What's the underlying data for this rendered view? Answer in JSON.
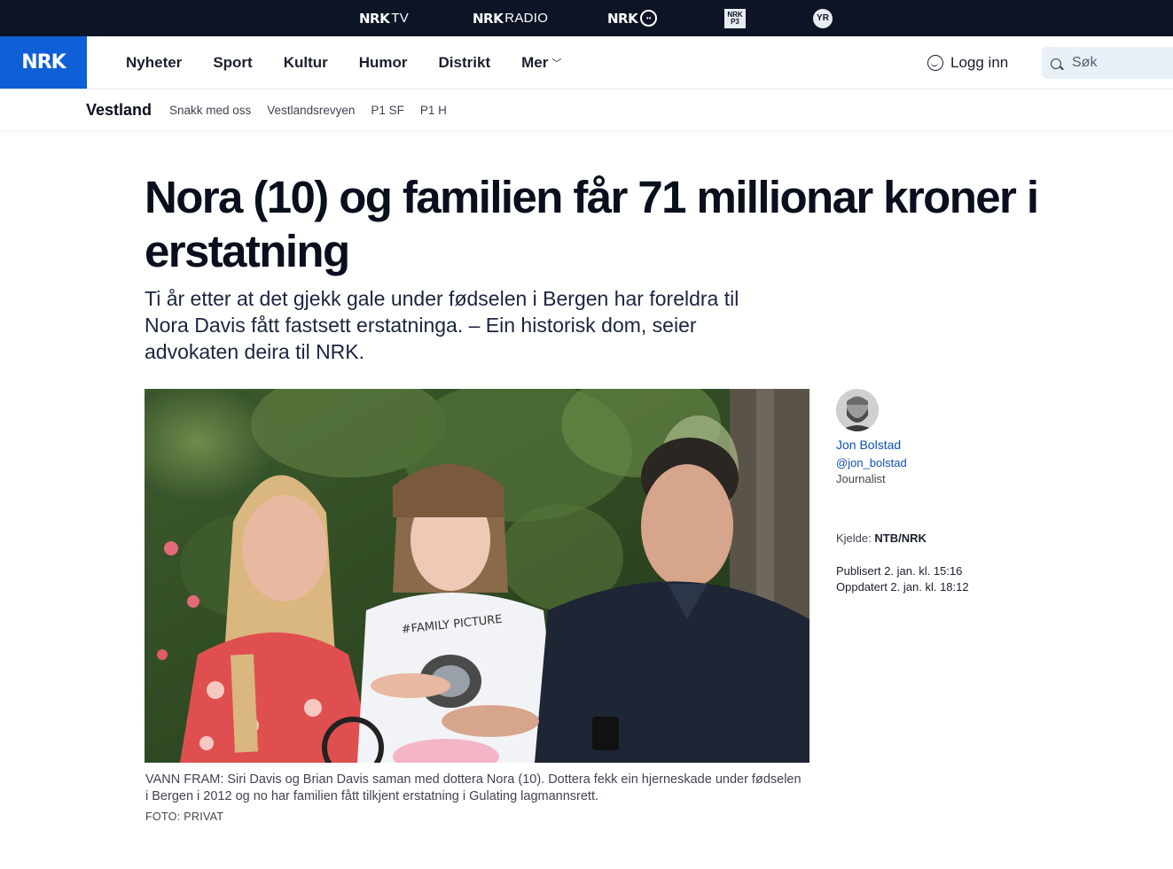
{
  "topbar": {
    "brands": [
      {
        "mark": "NRK",
        "sub": "TV"
      },
      {
        "mark": "NRK",
        "sub": "RADIO"
      },
      {
        "mark": "NRK",
        "sub": ""
      },
      {
        "mark": "NRK P3",
        "sub": ""
      },
      {
        "mark": "YR",
        "sub": ""
      }
    ]
  },
  "header": {
    "logo": "NRK",
    "nav": [
      "Nyheter",
      "Sport",
      "Kultur",
      "Humor",
      "Distrikt",
      "Mer"
    ],
    "login_label": "Logg inn",
    "search_placeholder": "Søk"
  },
  "subnav": {
    "region": "Vestland",
    "links": [
      "Snakk med oss",
      "Vestlandsrevyen",
      "P1 SF",
      "P1 H"
    ]
  },
  "article": {
    "title": "Nora (10) og familien får 71 millionar kroner i erstatning",
    "lead": "Ti år etter at det gjekk gale under fødselen i Bergen har foreldra til Nora Davis fått fastsett erstatninga. – Ein historisk dom, seier advokaten deira til NRK.",
    "caption": "VANN FRAM: Siri Davis og Brian Davis saman med dottera Nora (10). Dottera fekk ein hjerneskade under fødselen i Bergen i 2012 og no har familien fått tilkjent erstatning i Gulating lagmannsrett.",
    "photo_credit": "FOTO: PRIVAT",
    "shirt_text": "#FAMILY PICTURE"
  },
  "byline": {
    "name": "Jon Bolstad",
    "handle": "@jon_bolstad",
    "role": "Journalist",
    "source_label": "Kjelde: ",
    "source_value": "NTB/NRK",
    "published": "Publisert 2. jan. kl. 15:16",
    "updated": "Oppdatert 2. jan. kl. 18:12"
  },
  "colors": {
    "topbar": "#0c1425",
    "brand_blue": "#0f5fd6",
    "link": "#0f4fb3",
    "text": "#0a0f1e"
  }
}
